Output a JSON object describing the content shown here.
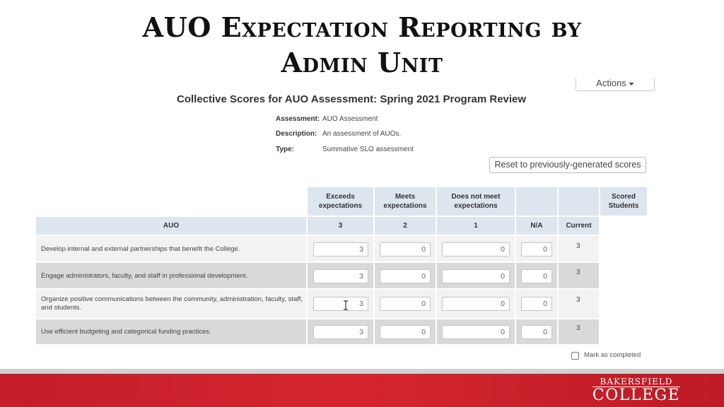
{
  "slide": {
    "title_line1": "AUO Expectation Reporting by",
    "title_line2": "Admin Unit"
  },
  "toolbar": {
    "actions_label": "Actions"
  },
  "panel": {
    "title": "Collective Scores for AUO Assessment: Spring 2021 Program Review",
    "meta": [
      {
        "label": "Assessment:",
        "value": "AUO Assessment"
      },
      {
        "label": "Description:",
        "value": "An assessment of AUOs."
      },
      {
        "label": "Type:",
        "value": "Summative SLO assessment"
      }
    ],
    "reset_label": "Reset to previously-generated scores"
  },
  "table": {
    "top_headers": [
      "Exceeds expectations",
      "Meets expectations",
      "Does not meet expectations",
      "",
      "",
      "Scored Students"
    ],
    "sub_headers": [
      "AUO",
      "3",
      "2",
      "1",
      "N/A",
      "Current"
    ],
    "rows": [
      {
        "auo": "Develop internal and external partnerships that benefit the College.",
        "exceeds": "3",
        "meets": "0",
        "not_meet": "0",
        "na": "0",
        "current": "3"
      },
      {
        "auo": "Engage administrators, faculty, and staff in professional development.",
        "exceeds": "3",
        "meets": "0",
        "not_meet": "0",
        "na": "0",
        "current": "3"
      },
      {
        "auo": "Organize positive communications between the community, administration, faculty, staff, and students.",
        "exceeds": "3",
        "meets": "0",
        "not_meet": "0",
        "na": "0",
        "current": "3"
      },
      {
        "auo": "Use efficient budgeting and categorical funding practices.",
        "exceeds": "3",
        "meets": "0",
        "not_meet": "0",
        "na": "0",
        "current": "3"
      }
    ]
  },
  "completion": {
    "label": "Mark as completed",
    "checked": false
  },
  "footer": {
    "logo_top": "BAKERSFIELD",
    "logo_bottom": "COLLEGE"
  },
  "colors": {
    "header_bg": "#dde6ef",
    "row_odd": "#f2f2f2",
    "row_even": "#d9d9d9",
    "footer_red": "#c41e2a"
  }
}
